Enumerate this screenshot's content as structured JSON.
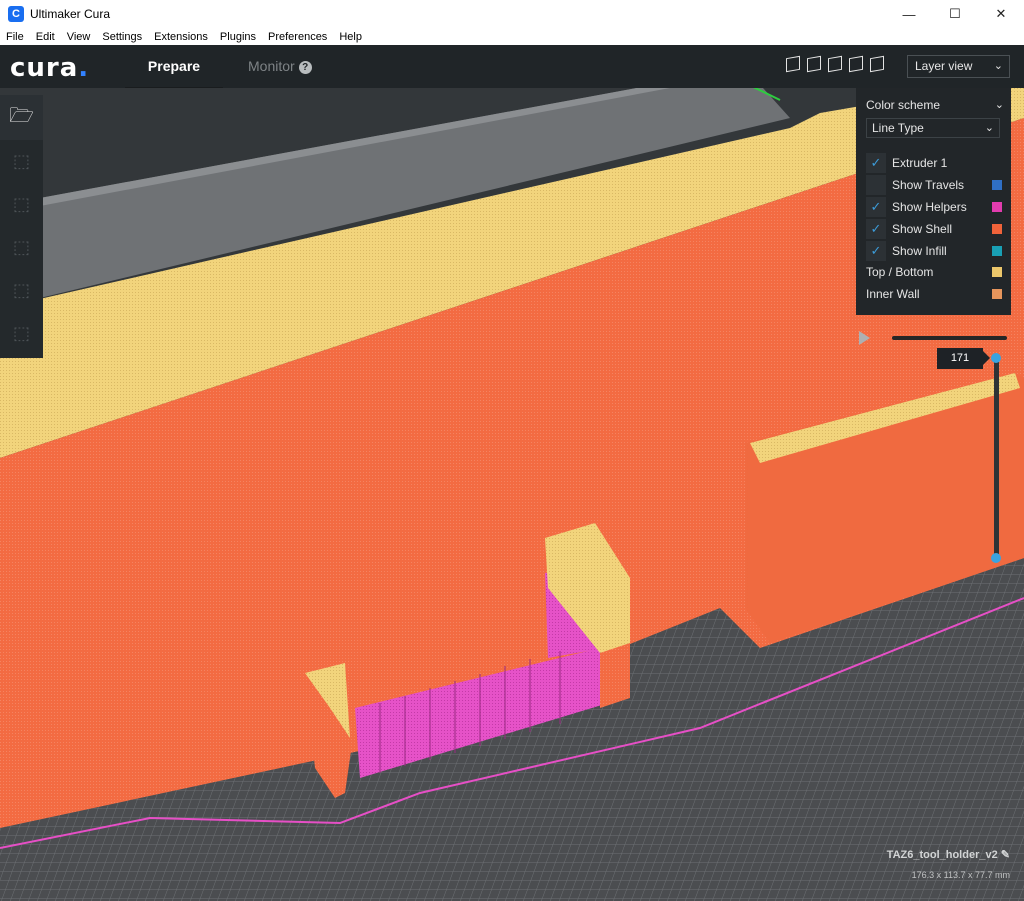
{
  "window": {
    "title": "Ultimaker Cura",
    "app_icon": "C",
    "minimize": "—",
    "maximize": "☐",
    "close": "✕"
  },
  "menu": [
    "File",
    "Edit",
    "View",
    "Settings",
    "Extensions",
    "Plugins",
    "Preferences",
    "Help"
  ],
  "header": {
    "logo": "cura",
    "logo_dot": ".",
    "tabs": {
      "prepare": "Prepare",
      "monitor": "Monitor"
    },
    "view_mode": "Layer view"
  },
  "color_panel": {
    "title": "Color scheme",
    "scheme": "Line Type",
    "options": [
      {
        "label": "Extruder 1",
        "checked": true,
        "color": null
      },
      {
        "label": "Show Travels",
        "checked": false,
        "color": "#2f6fc5"
      },
      {
        "label": "Show Helpers",
        "checked": true,
        "color": "#e23cae"
      },
      {
        "label": "Show Shell",
        "checked": true,
        "color": "#f0633a"
      },
      {
        "label": "Show Infill",
        "checked": true,
        "color": "#19a0b5"
      }
    ],
    "legend": [
      {
        "label": "Top / Bottom",
        "color": "#ecc76b"
      },
      {
        "label": "Inner Wall",
        "color": "#e6955c"
      }
    ]
  },
  "layer_slider": {
    "current_layer": "171"
  },
  "object": {
    "name": "TAZ6_tool_holder_v2",
    "dimensions": "176.3 x 113.7 x 77.7 mm"
  },
  "colors": {
    "shell": "#f26a40",
    "top_bottom": "#f2d27a",
    "helpers": "#e64fc6",
    "build_plate": "#4a4c4f"
  }
}
